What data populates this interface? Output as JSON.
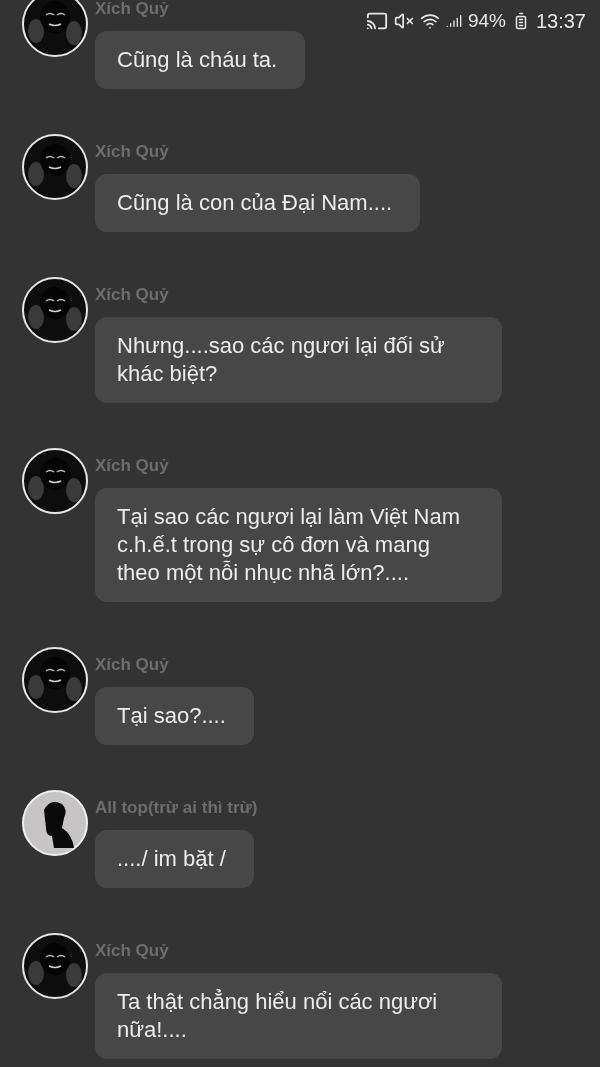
{
  "status_bar": {
    "battery": "94%",
    "time": "13:37"
  },
  "messages": [
    {
      "sender": "Xích Quỷ",
      "avatar": {
        "kind": "dark"
      },
      "text": "Cũng là cháu ta."
    },
    {
      "sender": "Xích Quỷ",
      "avatar": {
        "kind": "dark"
      },
      "text": "Cũng là con của Đại Nam...."
    },
    {
      "sender": "Xích Quỷ",
      "avatar": {
        "kind": "dark"
      },
      "text": "Nhưng....sao các ngươi lại đối sử khác biệt?"
    },
    {
      "sender": "Xích Quỷ",
      "avatar": {
        "kind": "dark"
      },
      "text": "Tại sao các ngươi lại làm Việt Nam c.h.ế.t trong sự cô đơn và mang theo một nỗi nhục nhã lớn?...."
    },
    {
      "sender": "Xích Quỷ",
      "avatar": {
        "kind": "dark"
      },
      "text": "Tại sao?...."
    },
    {
      "sender": "All top(trừ ai thì trừ)",
      "avatar": {
        "kind": "light"
      },
      "text": "..../ im bặt /"
    },
    {
      "sender": "Xích Quỷ",
      "avatar": {
        "kind": "dark"
      },
      "text": "Ta thật chẳng hiểu nổi các ngươi nữa!...."
    }
  ]
}
